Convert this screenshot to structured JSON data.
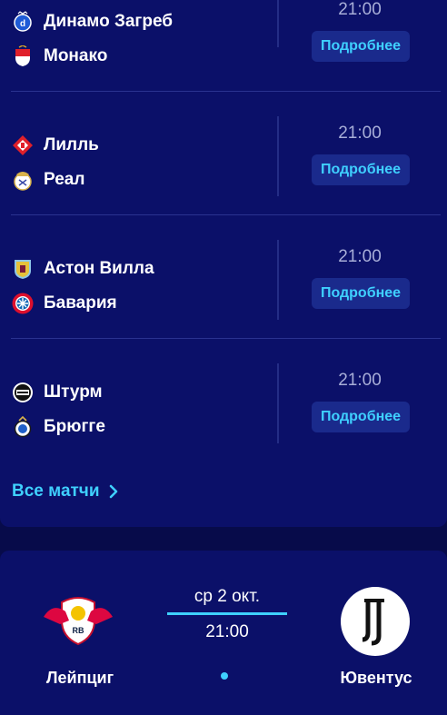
{
  "matches": [
    {
      "home": "Динамо Загреб",
      "away": "Монако",
      "time": "21:00",
      "button": "Подробнее"
    },
    {
      "home": "Лилль",
      "away": "Реал",
      "time": "21:00",
      "button": "Подробнее"
    },
    {
      "home": "Астон Вилла",
      "away": "Бавария",
      "time": "21:00",
      "button": "Подробнее"
    },
    {
      "home": "Штурм",
      "away": "Брюгге",
      "time": "21:00",
      "button": "Подробнее"
    }
  ],
  "all_matches_link": "Все матчи",
  "featured": {
    "home": "Лейпциг",
    "away": "Ювентус",
    "date": "ср 2 окт.",
    "time": "21:00"
  },
  "colors": {
    "background": "#070b4a",
    "card": "#0b1069",
    "accent": "#3fd0ff",
    "button_bg": "#1a2a8c"
  }
}
